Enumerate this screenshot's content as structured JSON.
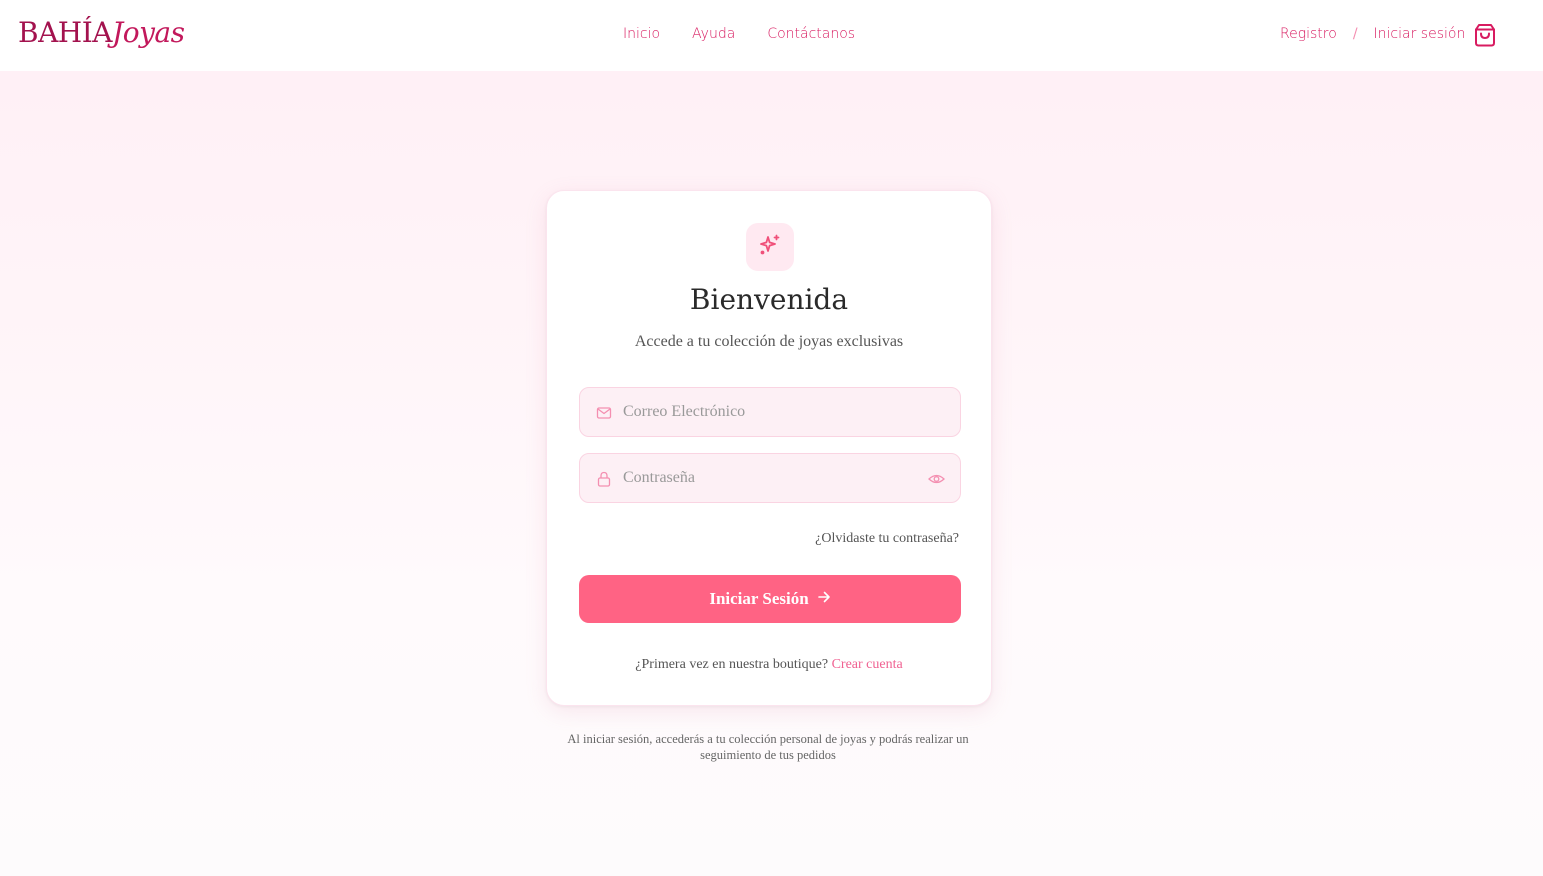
{
  "header": {
    "logo_primary": "BAHÍA",
    "logo_secondary": "Joyas",
    "nav": [
      "Inicio",
      "Ayuda",
      "Contáctanos"
    ],
    "register_label": "Registro",
    "separator": "/",
    "login_label": "Iniciar sesión",
    "cart_icon": "shopping-bag-icon"
  },
  "login_card": {
    "badge_icon": "sparkles-icon",
    "title": "Bienvenida",
    "subtitle": "Accede a tu colección de joyas exclusivas",
    "email_placeholder": "Correo Electrónico",
    "email_icon": "mail-icon",
    "password_placeholder": "Contraseña",
    "password_icon": "lock-icon",
    "toggle_icon": "eye-icon",
    "forgot_label": "¿Olvidaste tu contraseña?",
    "submit_label": "Iniciar Sesión",
    "submit_icon": "arrow-right-icon",
    "signup_prompt": "¿Primera vez en nuestra boutique?",
    "signup_link": "Crear cuenta"
  },
  "footnote": "Al iniciar sesión, accederás a tu colección personal de joyas y podrás realizar un seguimiento de tus pedidos",
  "colors": {
    "brand": "#a3124e",
    "accent": "#d81b60",
    "button": "#ff6384",
    "field_bg": "#fdf0f5"
  }
}
